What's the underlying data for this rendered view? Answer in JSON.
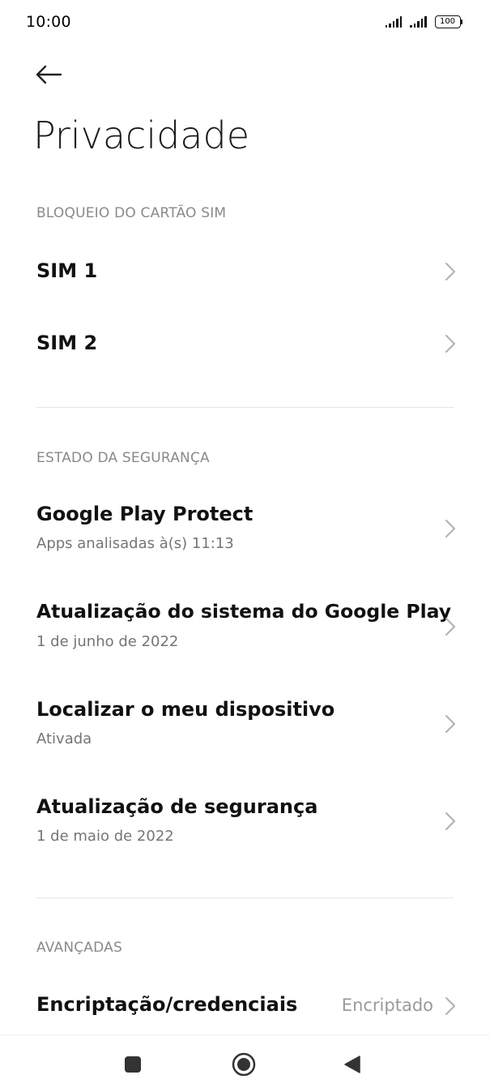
{
  "status_bar": {
    "time": "10:00",
    "battery_level": "100",
    "icons": [
      "signal-sim1-icon",
      "signal-sim2-icon",
      "battery-icon"
    ]
  },
  "header": {
    "back_icon": "arrow-left-icon",
    "title": "Privacidade"
  },
  "sections": {
    "sim_lock": {
      "header": "BLOQUEIO DO CARTÃO SIM",
      "items": [
        {
          "title": "SIM 1"
        },
        {
          "title": "SIM 2"
        }
      ]
    },
    "security_status": {
      "header": "ESTADO DA SEGURANÇA",
      "items": [
        {
          "title": "Google Play Protect",
          "subtitle": "Apps analisadas à(s) 11:13"
        },
        {
          "title": "Atualização do sistema do Google Play",
          "subtitle": "1 de junho de 2022"
        },
        {
          "title": "Localizar o meu dispositivo",
          "subtitle": "Ativada"
        },
        {
          "title": "Atualização de segurança",
          "subtitle": "1 de maio de 2022"
        }
      ]
    },
    "advanced": {
      "header": "AVANÇADAS",
      "items": [
        {
          "title": "Encriptação/credenciais",
          "value": "Encriptado"
        }
      ]
    }
  },
  "nav_bar": {
    "icons": [
      "recents-square-icon",
      "home-circle-icon",
      "back-triangle-icon"
    ]
  },
  "colors": {
    "title": "#1a1a1a",
    "section_header": "#8a8a8a",
    "subtitle": "#757575",
    "chevron": "#b0b0b0",
    "nav_icon": "#333333"
  }
}
